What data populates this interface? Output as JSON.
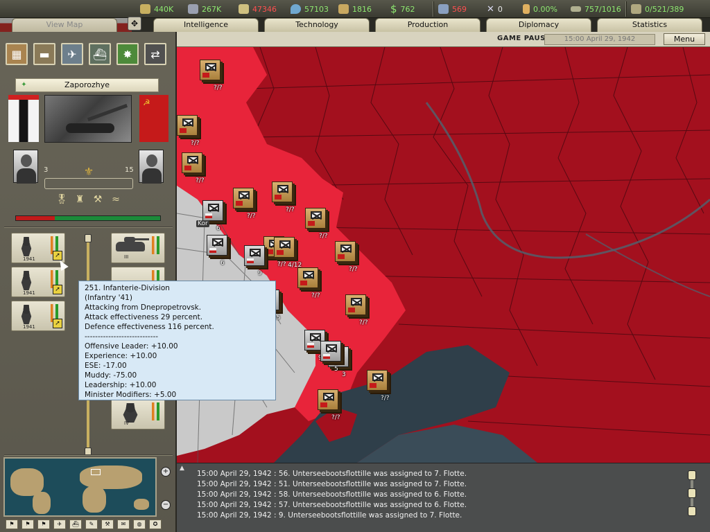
{
  "resources": [
    {
      "name": "energy",
      "value": "440K",
      "icon": "energy-icon",
      "color": "#8ee870"
    },
    {
      "name": "metal",
      "value": "267K",
      "icon": "metal-icon",
      "color": "#8ee870"
    },
    {
      "name": "rare-materials",
      "value": "47346",
      "icon": "rare-materials-icon",
      "color": "#ff5050"
    },
    {
      "name": "oil",
      "value": "57103",
      "icon": "oil-icon",
      "color": "#8ee870"
    },
    {
      "name": "supplies",
      "value": "1816",
      "icon": "supplies-icon",
      "color": "#8ee870"
    },
    {
      "name": "money",
      "value": "762",
      "icon": "money-icon",
      "color": "#8ee870"
    },
    {
      "name": "manpower",
      "value": "569",
      "icon": "manpower-icon",
      "color": "#ff5050"
    },
    {
      "name": "transports",
      "value": "0",
      "icon": "crossed-swords-icon",
      "color": "#e8e8e8"
    },
    {
      "name": "dissent",
      "value": "0.00%",
      "icon": "dissent-icon",
      "color": "#8ee870"
    },
    {
      "name": "convoys",
      "value": "757/1016",
      "icon": "convoy-icon",
      "color": "#8ee870"
    },
    {
      "name": "escorts",
      "value": "0/521/389",
      "icon": "escort-icon",
      "color": "#8ee870"
    }
  ],
  "tabs": [
    "View Map",
    "Intelligence",
    "Technology",
    "Production",
    "Diplomacy",
    "Statistics"
  ],
  "status": {
    "paused": "GAME PAUSED",
    "date": "15:00 April 29, 1942",
    "menu": "Menu"
  },
  "battle": {
    "province": "Zaporozhye",
    "attacker_level": "3",
    "defender_level": "15",
    "strength_attacker_fraction": 0.27
  },
  "units": {
    "left": [
      {
        "year": "1941"
      },
      {
        "year": "1941"
      },
      {
        "year": "1941"
      }
    ],
    "right": [
      {
        "label": "III"
      },
      {
        "label": ""
      },
      {
        "label": "IV"
      }
    ]
  },
  "tooltip": [
    "251. Infanterie-Division",
    "(Infantry '41)",
    "Attacking from Dnepropetrovsk.",
    "Attack effectiveness 29 percent.",
    "Defence effectiveness 116 percent.",
    "----------------------------",
    "Offensive Leader: +10.00",
    "Experience: +10.00",
    "ESE: -17.00",
    "Muddy: -75.00",
    "Leadership: +10.00",
    "Minister Modifiers: +5.00"
  ],
  "map_counters": [
    {
      "side": "sov",
      "label": "?/?"
    },
    {
      "side": "sov",
      "label": "?/?"
    },
    {
      "side": "sov",
      "label": "?/?"
    },
    {
      "side": "sov",
      "label": "?/?"
    },
    {
      "side": "sov",
      "label": "?/?"
    },
    {
      "side": "sov",
      "label": "?/?"
    },
    {
      "side": "sov",
      "label": "?/?"
    },
    {
      "side": "sov",
      "label": "?/?"
    },
    {
      "side": "sov",
      "label": "4/12"
    },
    {
      "side": "sov",
      "label": "?/?"
    },
    {
      "side": "sov",
      "label": "?/?"
    },
    {
      "side": "sov",
      "label": "?/?"
    },
    {
      "side": "sov",
      "label": "?/?"
    },
    {
      "side": "ger",
      "label": "6"
    },
    {
      "side": "ger",
      "label": "6"
    },
    {
      "side": "ger",
      "label": "9"
    },
    {
      "side": "ger",
      "label": "9"
    },
    {
      "side": "ger",
      "label": "3"
    },
    {
      "side": "ger",
      "label": "5"
    },
    {
      "side": "ger",
      "label": "15"
    }
  ],
  "log": [
    "15:00 April 29, 1942 : 56. Unterseebootsflottille was assigned to 7. Flotte.",
    "15:00 April 29, 1942 : 51. Unterseebootsflottille was assigned to 7. Flotte.",
    "15:00 April 29, 1942 : 58. Unterseebootsflottille was assigned to 6. Flotte.",
    "15:00 April 29, 1942 : 57. Unterseebootsflottille was assigned to 6. Flotte.",
    "15:00 April 29, 1942 : 9. Unterseebootsflottille was assigned to 7. Flotte."
  ],
  "colors": {
    "soviet_dark": "#a3101e",
    "soviet_bright": "#e8243a",
    "german": "#c9c9c9",
    "sea": "#30404a"
  }
}
